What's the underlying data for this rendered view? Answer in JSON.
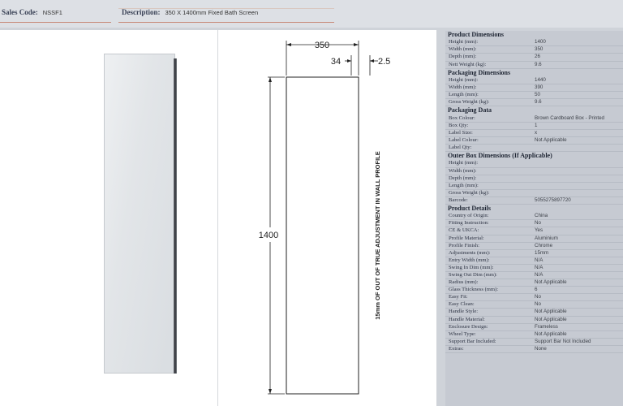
{
  "header": {
    "sales_code_label": "Sales Code:",
    "sales_code_value": "NSSF1",
    "description_label": "Description:",
    "description_value": "350 X 1400mm Fixed Bath Screen"
  },
  "drawing": {
    "width_label": "350",
    "left_gap_label": "34",
    "right_gap_label": "2.5",
    "height_label": "1400",
    "note": "15mm OF OUT OF TRUE ADJUSTMENT IN WALL PROFILE"
  },
  "specs": {
    "product_dimensions": {
      "title": "Product Dimensions",
      "rows": [
        {
          "k": "Height (mm):",
          "v": "1400"
        },
        {
          "k": "Width (mm):",
          "v": "350"
        },
        {
          "k": "Depth (mm):",
          "v": "26"
        },
        {
          "k": "Nett Weight (kg):",
          "v": "9.6"
        }
      ]
    },
    "packaging_dimensions": {
      "title": "Packaging  Dimensions",
      "rows": [
        {
          "k": "Height (mm):",
          "v": "1440"
        },
        {
          "k": "Width (mm):",
          "v": "390"
        },
        {
          "k": "Length (mm):",
          "v": "50"
        },
        {
          "k": "Gross Weight (kg):",
          "v": "9.6"
        }
      ]
    },
    "packaging_data": {
      "title": "Packaging Data",
      "rows": [
        {
          "k": "Box Colour:",
          "v": "Brown Cardboard Box - Printed"
        },
        {
          "k": "Box Qty:",
          "v": "1"
        },
        {
          "k": "Label Size:",
          "v": "x"
        },
        {
          "k": "Label Colour:",
          "v": "Not Applicable"
        },
        {
          "k": "Label Qty:",
          "v": ""
        }
      ]
    },
    "outer_box": {
      "title": "Outer Box Dimensions (If Applicable)",
      "rows": [
        {
          "k": "Height (mm):",
          "v": ""
        },
        {
          "k": "Width (mm):",
          "v": ""
        },
        {
          "k": "Depth (mm):",
          "v": ""
        },
        {
          "k": "Length (mm):",
          "v": ""
        },
        {
          "k": "Gross Weight (kg):",
          "v": ""
        },
        {
          "k": "Barcode:",
          "v": "5055275897720"
        }
      ]
    },
    "product_details": {
      "title": "Product Details",
      "rows": [
        {
          "k": "Country of Origin:",
          "v": "China"
        },
        {
          "k": "Fitting Instruction:",
          "v": "No"
        },
        {
          "k": "CE & UKCA:",
          "v": "Yes"
        },
        {
          "k": "Profile Material:",
          "v": "Aluminium"
        },
        {
          "k": "Profile Finish:",
          "v": "Chrome"
        },
        {
          "k": "Adjustments (mm):",
          "v": "15mm"
        },
        {
          "k": "Entry Width (mm):",
          "v": "N/A"
        },
        {
          "k": "Swing In Dim (mm):",
          "v": "N/A"
        },
        {
          "k": "Swing Out Dim (mm):",
          "v": "N/A"
        },
        {
          "k": "Radius (mm):",
          "v": "Not Applicable"
        },
        {
          "k": "Glass Thickness (mm):",
          "v": "6"
        },
        {
          "k": "Easy Fit:",
          "v": "No"
        },
        {
          "k": "Easy Clean:",
          "v": "No"
        },
        {
          "k": "Handle Style:",
          "v": "Not Applicable"
        },
        {
          "k": "Handle Material:",
          "v": "Not Applicable"
        },
        {
          "k": "Enclosure Design:",
          "v": "Frameless"
        },
        {
          "k": "Wheel Type:",
          "v": "Not Applicable"
        },
        {
          "k": "Support Bar Included:",
          "v": "Support Bar Not Included"
        },
        {
          "k": "Extras:",
          "v": "None"
        }
      ]
    }
  }
}
